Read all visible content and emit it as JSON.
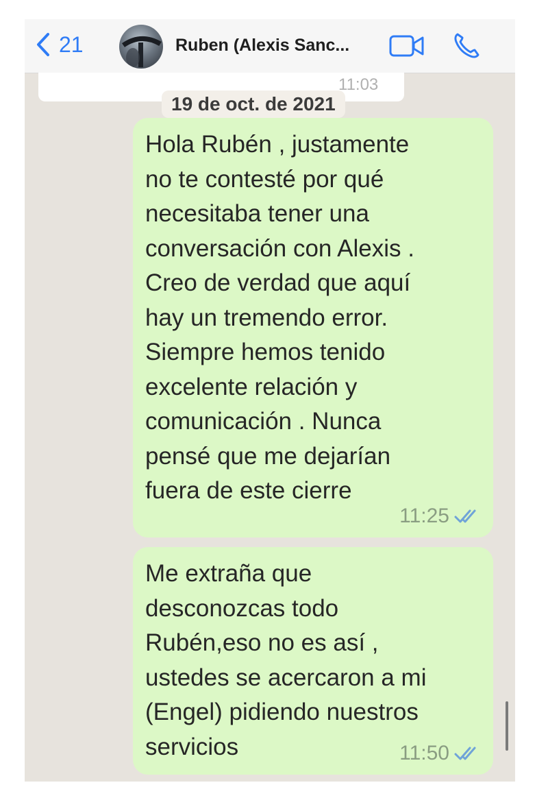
{
  "header": {
    "back_count": "21",
    "contact_name": "Ruben (Alexis Sanc...",
    "icons": {
      "back": "chevron-left-icon",
      "video": "video-camera-icon",
      "call": "phone-icon"
    }
  },
  "chat": {
    "prev_time": "11:03",
    "date_label": "19 de oct. de 2021",
    "messages": [
      {
        "text": "Hola Rubén , justamente\nno te contesté por qué\nnecesitaba tener una\nconversación con Alexis .\nCreo de verdad que aquí\nhay un tremendo error.\nSiempre hemos tenido\nexcelente relación y\ncomunicación . Nunca\npensé que me dejarían\nfuera de este cierre",
        "time": "11:25",
        "status": "read"
      },
      {
        "text": "Me extraña que\ndesconozcas todo\nRubén,eso no es así ,\nustedes se acercaron a mi\n(Engel) pidiendo nuestros\nservicios",
        "time": "11:50",
        "status": "read"
      }
    ]
  },
  "colors": {
    "accent": "#2f7cf6",
    "outgoing_bubble": "#dcf8c6",
    "chat_background": "#e7e3dd",
    "header_background": "#f6f6f6",
    "read_ticks": "#6fa3d8"
  }
}
